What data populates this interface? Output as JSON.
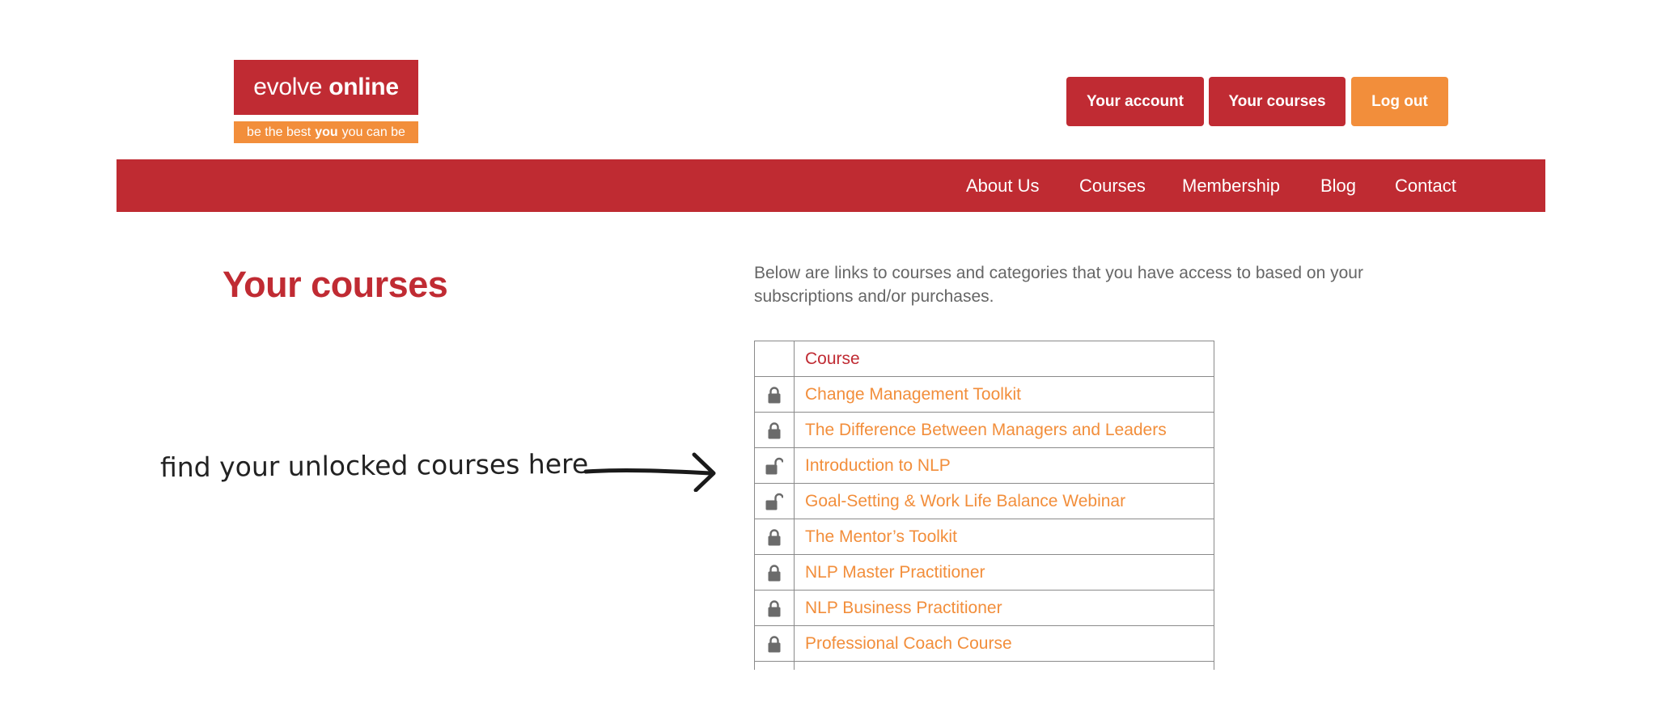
{
  "brand": {
    "name_light": "evolve",
    "name_bold": "online",
    "tagline_before": "be the best",
    "tagline_bold": "you",
    "tagline_after": "you can be",
    "colors": {
      "red": "#c02b33",
      "orange": "#f28e3b"
    }
  },
  "header": {
    "account_label": "Your account",
    "courses_label": "Your courses",
    "logout_label": "Log out"
  },
  "nav": {
    "about": "About Us",
    "courses": "Courses",
    "membership": "Membership",
    "blog": "Blog",
    "contact": "Contact"
  },
  "main": {
    "title": "Your courses",
    "intro": "Below are links to courses and categories that you have access to based on your subscriptions and/or purchases.",
    "table_header": "Course",
    "courses": [
      {
        "name": "Change Management Toolkit",
        "status": "lock-icon"
      },
      {
        "name": "The Difference Between Managers and Leaders",
        "status": "lock-icon"
      },
      {
        "name": "Introduction to NLP",
        "status": "unlock-icon"
      },
      {
        "name": "Goal-Setting & Work Life Balance Webinar",
        "status": "unlock-icon"
      },
      {
        "name": "The Mentor’s Toolkit",
        "status": "lock-icon"
      },
      {
        "name": "NLP Master Practitioner",
        "status": "lock-icon"
      },
      {
        "name": "NLP Business Practitioner",
        "status": "lock-icon"
      },
      {
        "name": "Professional Coach Course",
        "status": "lock-icon"
      }
    ]
  },
  "annotation": {
    "text": "find your unlocked courses here",
    "icon": "arrow-right-icon"
  }
}
